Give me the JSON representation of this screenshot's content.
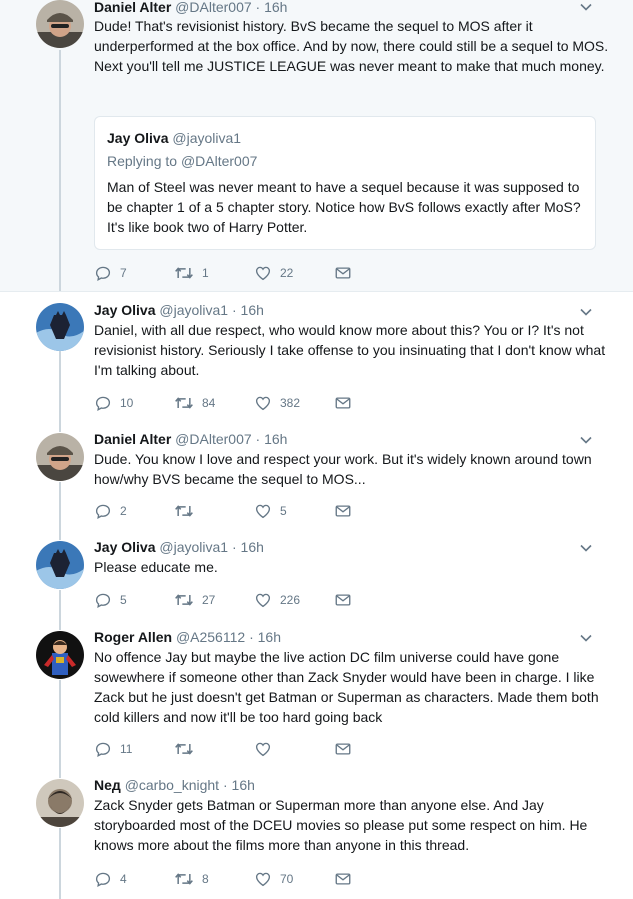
{
  "tweets": [
    {
      "name": "Daniel Alter",
      "handle": "@DAlter007",
      "time": "16h",
      "text": "Dude!  That's revisionist history.  BvS became the sequel to MOS after it underperformed at the box office.  And by now, there could still be a sequel to MOS.  Next you'll tell me JUSTICE LEAGUE was never meant to make that much money.",
      "reply_count": "7",
      "retweet_count": "1",
      "like_count": "22",
      "quote": {
        "name": "Jay Oliva",
        "handle": "@jayoliva1",
        "replying_label": "Replying to",
        "replying_to": "@DAlter007",
        "text": "Man of Steel was never meant to have a sequel because it was supposed to be chapter 1 of a 5 chapter story. Notice how BvS follows exactly after MoS? It's like book two of Harry Potter."
      }
    },
    {
      "name": "Jay Oliva",
      "handle": "@jayoliva1",
      "time": "16h",
      "text": "Daniel, with all due respect, who would know more about this? You or I? It's not revisionist history. Seriously I take offense to you insinuating that I don't know what I'm talking about.",
      "reply_count": "10",
      "retweet_count": "84",
      "like_count": "382"
    },
    {
      "name": "Daniel Alter",
      "handle": "@DAlter007",
      "time": "16h",
      "text": "Dude. You know I love and respect your work. But it's widely known around town how/why BVS became the sequel to MOS...",
      "reply_count": "2",
      "retweet_count": "",
      "like_count": "5"
    },
    {
      "name": "Jay Oliva",
      "handle": "@jayoliva1",
      "time": "16h",
      "text": "Please educate me.",
      "reply_count": "5",
      "retweet_count": "27",
      "like_count": "226"
    },
    {
      "name": "Roger Allen",
      "handle": "@A256112",
      "time": "16h",
      "text": "No offence Jay but maybe the live action DC film universe could have gone sowewhere if someone other than Zack Snyder would have been in charge. I like Zack but he just doesn't get Batman or Superman as characters. Made them both cold killers and now it'll be too hard going back",
      "reply_count": "11",
      "retweet_count": "",
      "like_count": ""
    },
    {
      "name": "Neд",
      "handle": "@carbo_knight",
      "time": "16h",
      "text": "Zack Snyder gets Batman or Superman more than anyone else. And Jay storyboarded most of the DCEU movies so please put some respect on him. He knows more about the films more than anyone in this thread.",
      "reply_count": "4",
      "retweet_count": "8",
      "like_count": "70"
    }
  ],
  "separator": "·",
  "colors": {
    "text": "#14171a",
    "secondary": "#657786",
    "link": "#1da1f2",
    "highlight_bg": "#f5f8fa",
    "border": "#e6ecf0",
    "thread_line": "#ccd6dd"
  },
  "icons": [
    "reply-icon",
    "retweet-icon",
    "like-icon",
    "message-icon",
    "caret-down-icon"
  ]
}
